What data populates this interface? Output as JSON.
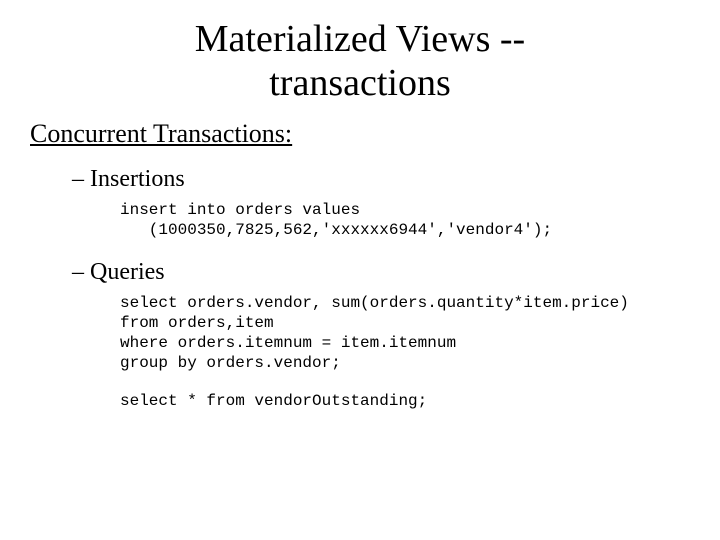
{
  "title_line1": "Materialized Views --",
  "title_line2": "transactions",
  "subtitle": "Concurrent Transactions:",
  "bullets": {
    "insertions": "Insertions",
    "queries": "Queries"
  },
  "dash": "–",
  "code": {
    "insert_line1": "insert into orders values",
    "insert_line2": "   (1000350,7825,562,'xxxxxx6944','vendor4');",
    "query1_line1": "select orders.vendor, sum(orders.quantity*item.price)",
    "query1_line2": "from orders,item",
    "query1_line3": "where orders.itemnum = item.itemnum",
    "query1_line4": "group by orders.vendor;",
    "query2_line1": "select * from vendorOutstanding;"
  }
}
